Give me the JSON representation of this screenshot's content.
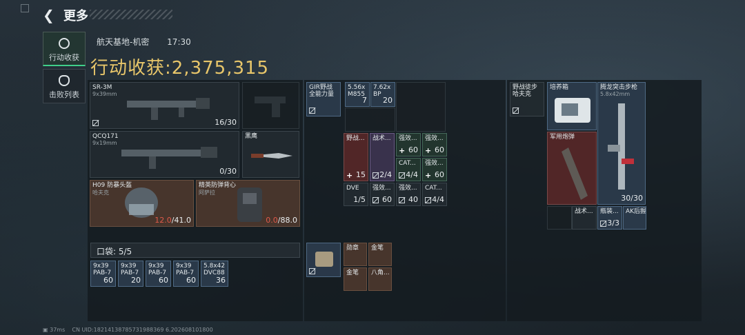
{
  "header": {
    "title": "更多",
    "back_icon": "back-arrow-icon"
  },
  "tabs": [
    {
      "label": "行动收获",
      "icon": "loot-icon",
      "active": true
    },
    {
      "label": "击败列表",
      "icon": "skull-icon",
      "active": false
    }
  ],
  "info": {
    "map": "航天基地-机密",
    "time": "17:30"
  },
  "harvest": {
    "label": "行动收获:",
    "value": "2,375,315"
  },
  "weapons": [
    {
      "name": "SR-3M",
      "caliber": "9x39mm",
      "ammo": "16/30"
    },
    {
      "name": "QCQ171",
      "caliber": "9x19mm",
      "ammo": "0/30"
    }
  ],
  "melee": {
    "name": "黑鹰"
  },
  "helmet": {
    "name": "H09 防暴头盔",
    "maker": "哈夫克",
    "dur_current": "12.0",
    "dur_max": "/41.0"
  },
  "armor": {
    "name": "精英防弹背心",
    "maker": "阿萨拉",
    "dur_current": "0.0",
    "dur_max": "/88.0"
  },
  "pocket": {
    "label": "口袋:",
    "value": "5/5",
    "items": [
      {
        "name": "9x39\nPAB-7",
        "count": "60"
      },
      {
        "name": "9x39\nPAB-7",
        "count": "20"
      },
      {
        "name": "9x39\nPAB-7",
        "count": "60"
      },
      {
        "name": "9x39\nPAB-7",
        "count": "60"
      },
      {
        "name": "5.8x42\nDVC88",
        "count": "36"
      }
    ]
  },
  "chest": {
    "name": "GIR野战\n全能力量"
  },
  "ammo_top": [
    {
      "name": "5.56x\nM855",
      "count": "7"
    },
    {
      "name": "7.62x\nBP",
      "count": "20"
    }
  ],
  "grid": [
    {
      "name": "野战...",
      "count": "15"
    },
    {
      "name": "战术...",
      "count": "2/4"
    },
    {
      "name": "强效...",
      "count": "60"
    },
    {
      "name": "强效...",
      "count": "60"
    },
    {
      "name": "CAT...",
      "count": "4/4"
    },
    {
      "name": "强效...",
      "count": "60"
    },
    {
      "name": "DVE",
      "count": "1/5"
    },
    {
      "name": "强效...",
      "count": "60"
    },
    {
      "name": "强效...",
      "count": "40"
    },
    {
      "name": "CAT...",
      "count": "4/4"
    }
  ],
  "bag": {
    "name": "野战徒步\n哈夫克"
  },
  "loot": [
    {
      "name": "培养箱"
    },
    {
      "name": "腾龙突击步枪",
      "caliber": "5.8x42mm",
      "ammo": "30/30"
    },
    {
      "name": "军用炮弹"
    },
    {
      "name": "战术..."
    },
    {
      "name": "瓶装...",
      "count": "3/3"
    },
    {
      "name": "AK后握"
    }
  ],
  "backpack_small": [
    {
      "name": "勋章"
    },
    {
      "name": "金笔"
    },
    {
      "name": "金笔"
    },
    {
      "name": "八角..."
    }
  ],
  "footer": {
    "ping": "37ms",
    "uid": "CN UID:18214138785731988369 6.202608101800"
  }
}
